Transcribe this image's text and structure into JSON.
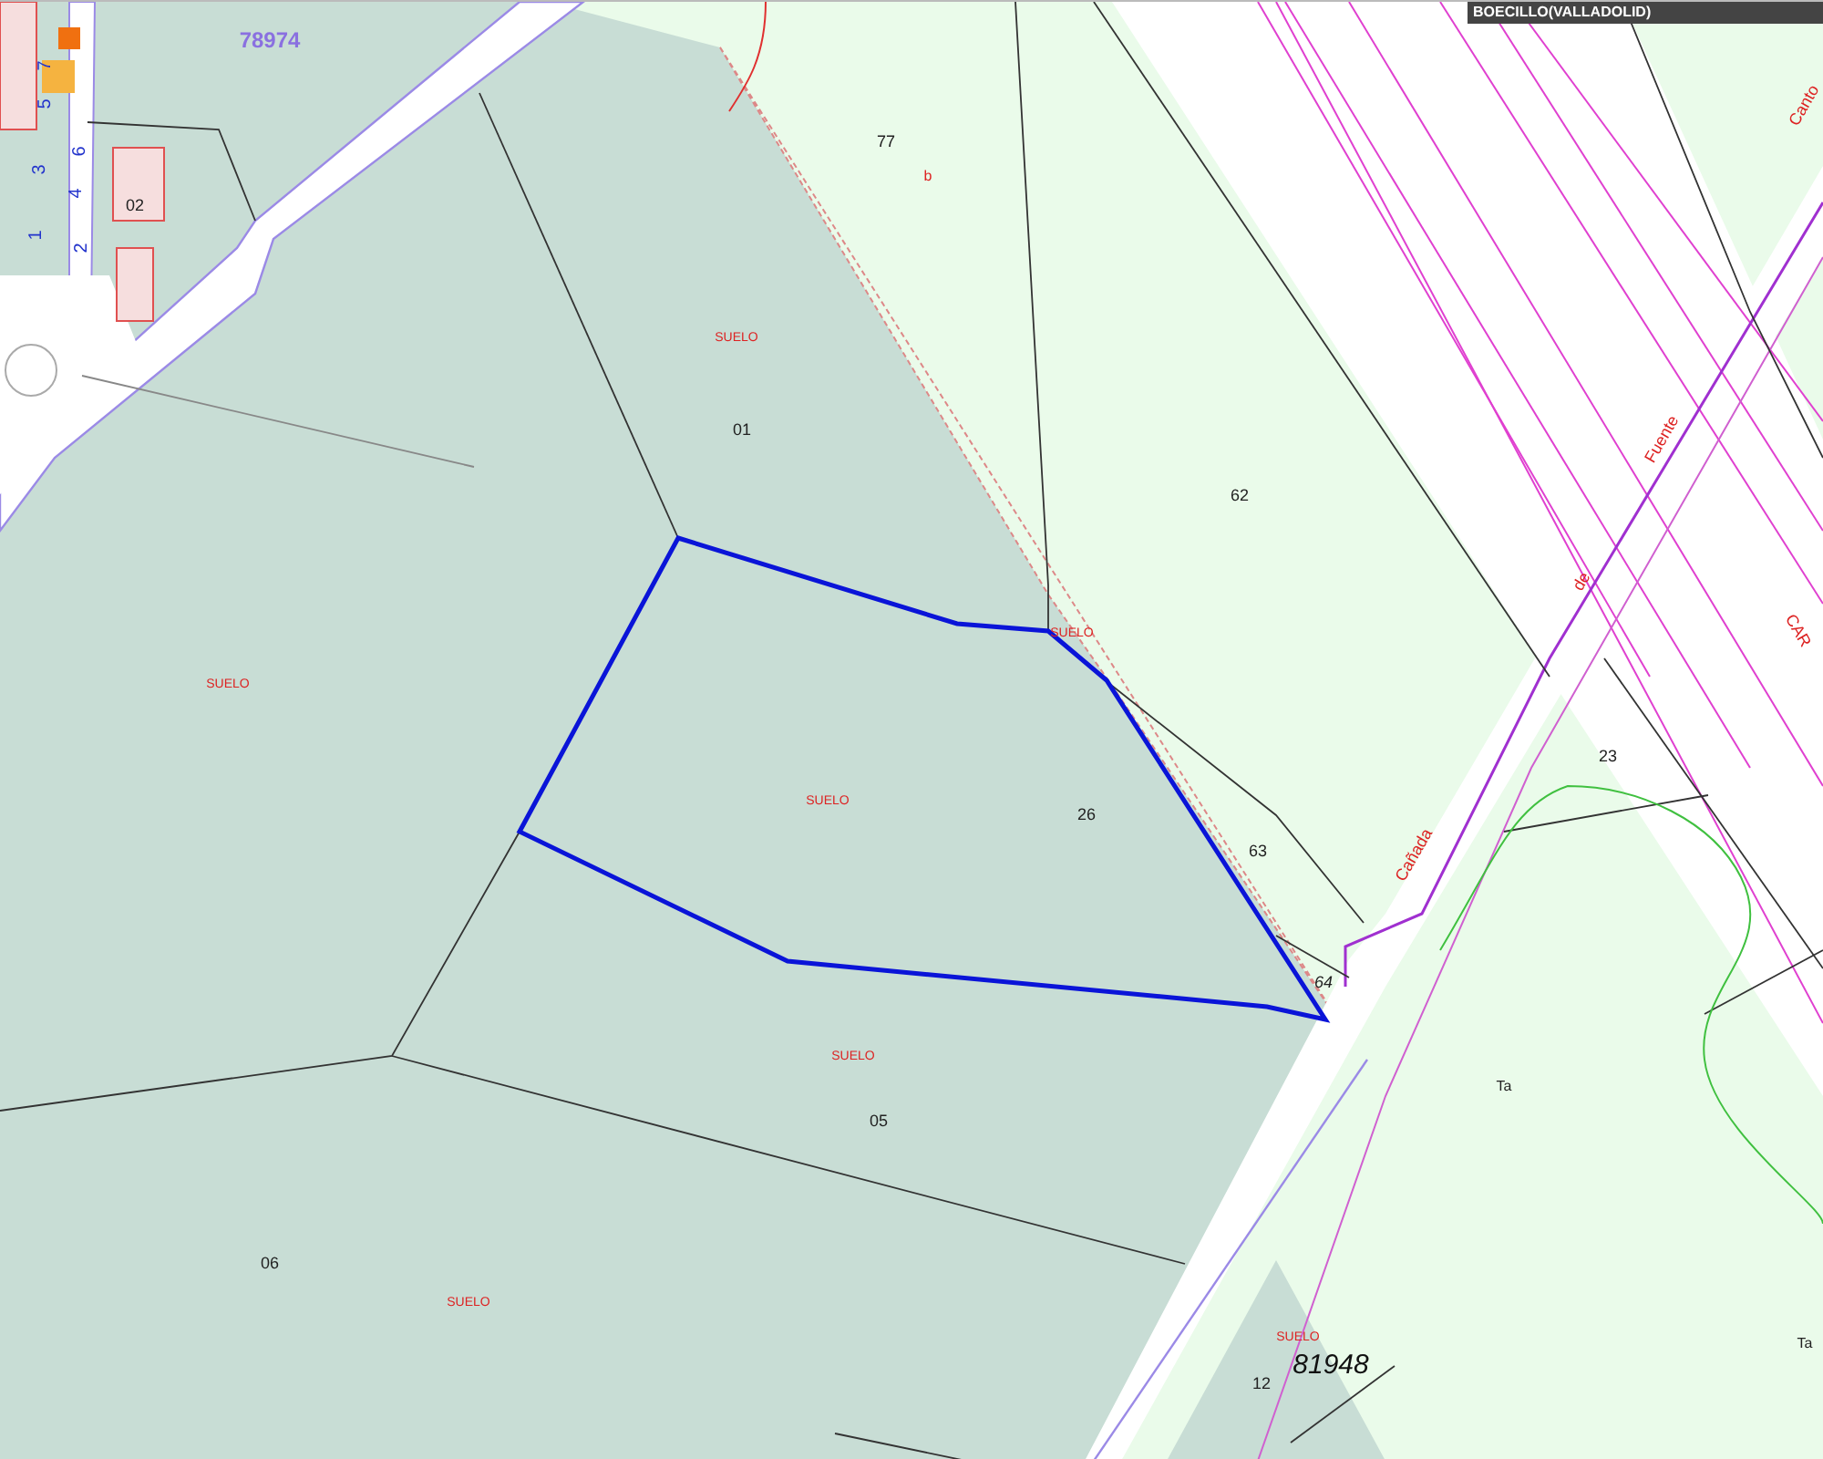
{
  "map": {
    "location_label": "BOECILLO(VALLADOLID)",
    "labels": [
      {
        "kind": "block",
        "text": "78974"
      },
      {
        "kind": "house",
        "text": "7"
      },
      {
        "kind": "house",
        "text": "5"
      },
      {
        "kind": "house",
        "text": "3"
      },
      {
        "kind": "house",
        "text": "1"
      },
      {
        "kind": "house",
        "text": "6"
      },
      {
        "kind": "house",
        "text": "4"
      },
      {
        "kind": "house",
        "text": "2"
      },
      {
        "kind": "parcel",
        "text": "02"
      },
      {
        "kind": "note",
        "text": "b"
      },
      {
        "kind": "parcel",
        "text": "77"
      },
      {
        "kind": "land",
        "text": "SUELO"
      },
      {
        "kind": "parcel",
        "text": "01"
      },
      {
        "kind": "street",
        "text": "Canto"
      },
      {
        "kind": "parcel",
        "text": "62"
      },
      {
        "kind": "street",
        "text": "Fuente"
      },
      {
        "kind": "street",
        "text": "de"
      },
      {
        "kind": "street",
        "text": "CAR"
      },
      {
        "kind": "land",
        "text": "SUELO"
      },
      {
        "kind": "land",
        "text": "SUELO"
      },
      {
        "kind": "land",
        "text": "SUELO"
      },
      {
        "kind": "parcel",
        "text": "26"
      },
      {
        "kind": "parcel",
        "text": "63"
      },
      {
        "kind": "street",
        "text": "Cañada"
      },
      {
        "kind": "parcel",
        "text": "23"
      },
      {
        "kind": "parcel-italic",
        "text": "64"
      },
      {
        "kind": "land",
        "text": "SUELO"
      },
      {
        "kind": "subparcel",
        "text": "Ta"
      },
      {
        "kind": "parcel",
        "text": "05"
      },
      {
        "kind": "parcel",
        "text": "06"
      },
      {
        "kind": "land",
        "text": "SUELO"
      },
      {
        "kind": "land",
        "text": "SUELO"
      },
      {
        "kind": "block-italic",
        "text": "81948"
      },
      {
        "kind": "parcel",
        "text": "12"
      },
      {
        "kind": "subparcel",
        "text": "Ta"
      }
    ]
  }
}
